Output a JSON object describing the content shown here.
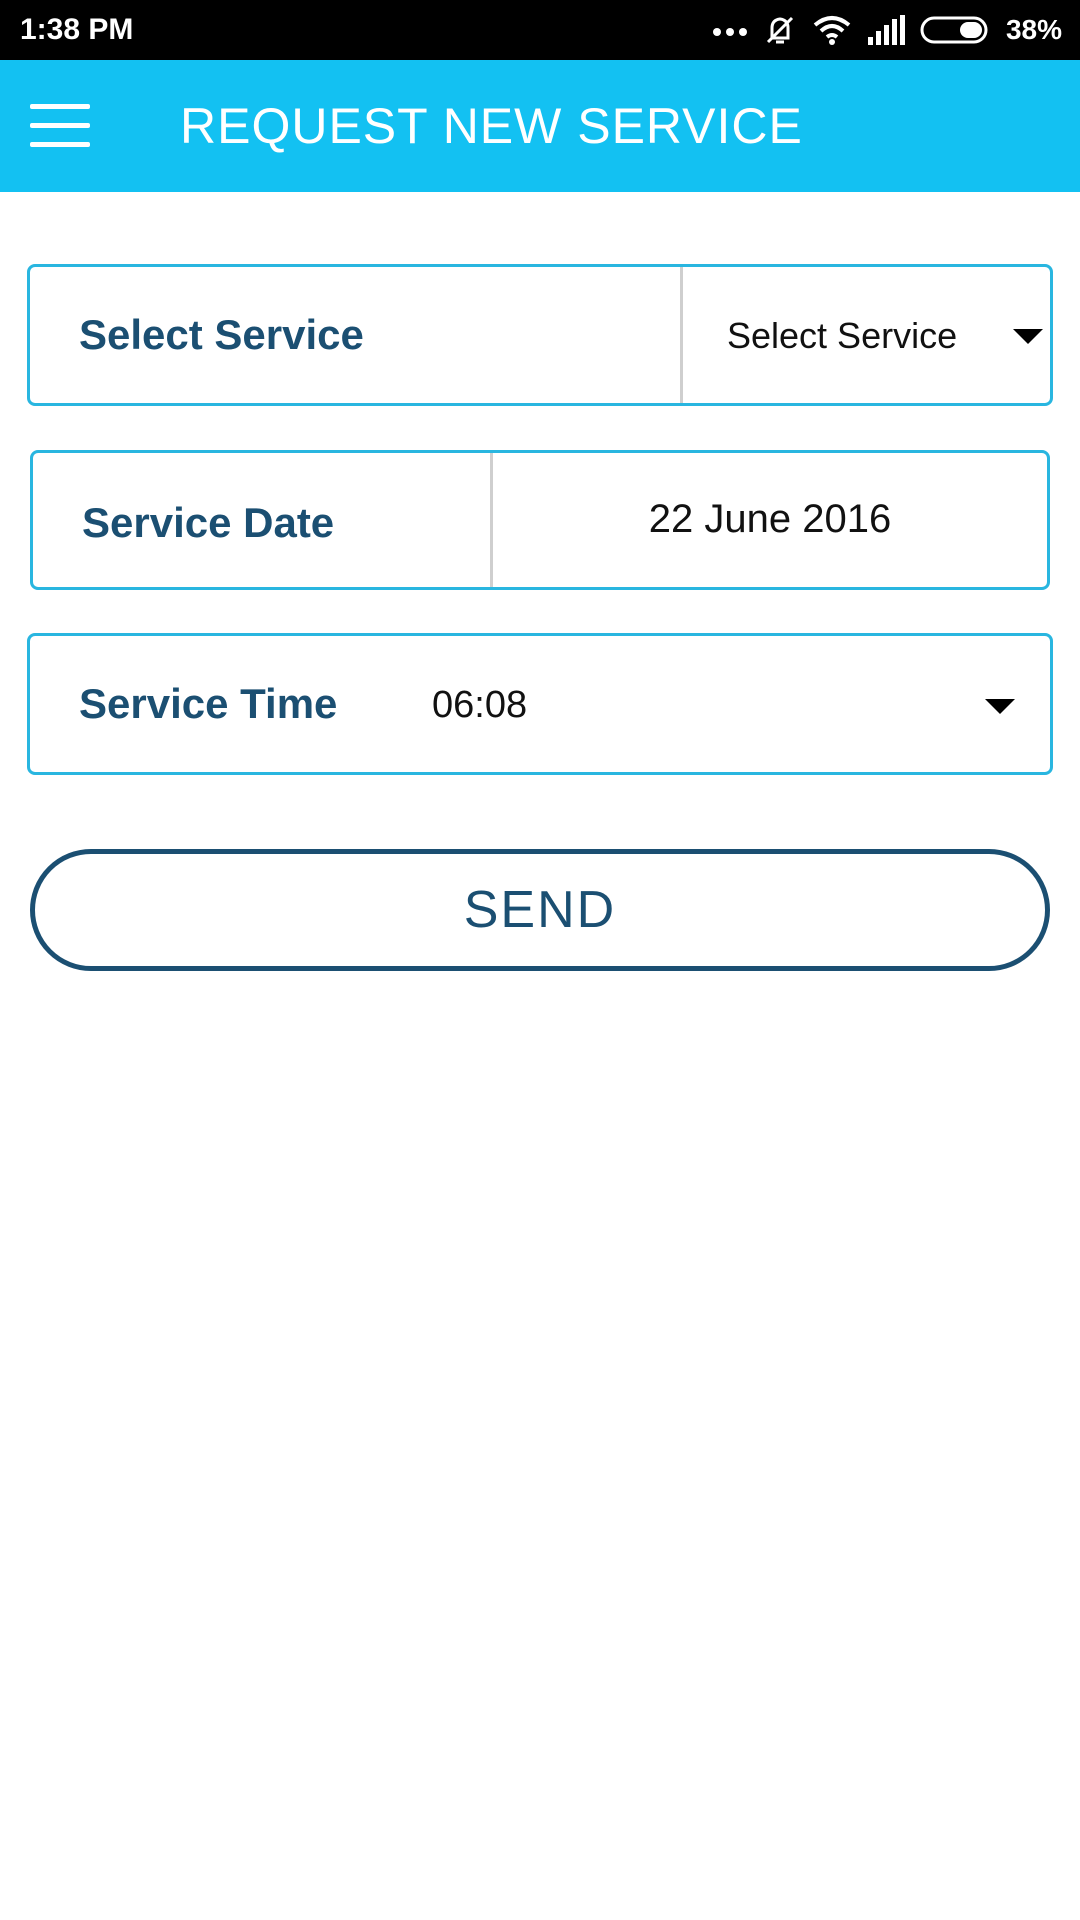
{
  "status_bar": {
    "time": "1:38 PM",
    "icons": [
      "more-dots-icon",
      "mute-icon",
      "wifi-icon",
      "signal-icon",
      "battery-icon"
    ],
    "battery_percent": "38%"
  },
  "app_bar": {
    "title": "REQUEST NEW SERVICE",
    "menu_icon": "hamburger-menu-icon",
    "background_color": "#13c1f2"
  },
  "form": {
    "service": {
      "label": "Select Service",
      "selected": "Select Service"
    },
    "date": {
      "label": "Service Date",
      "value": "22 June 2016"
    },
    "time": {
      "label": "Service Time",
      "value": "06:08"
    }
  },
  "send_button": {
    "label": "SEND"
  },
  "colors": {
    "accent": "#13c1f2",
    "border": "#29b6e0",
    "label_text": "#1b4f72"
  }
}
